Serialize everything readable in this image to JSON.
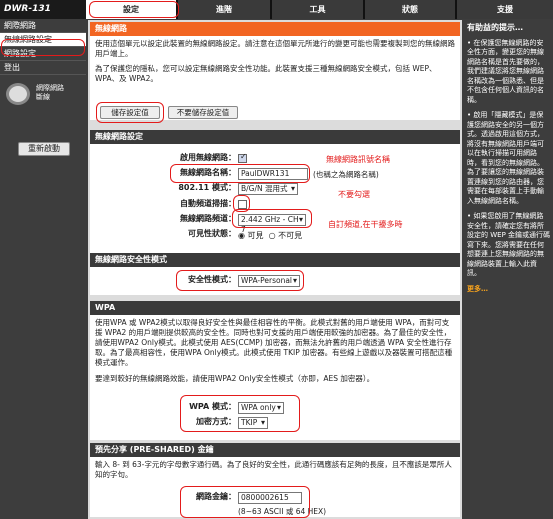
{
  "brand": "DWR-131",
  "tabs": [
    "設定",
    "進階",
    "工具",
    "狀態",
    "支援"
  ],
  "nav": [
    "網際網路",
    "無線網路設定",
    "網路設定",
    "登出"
  ],
  "sidebar": {
    "device_label": "網際網路\n斷線",
    "reboot": "重新啟動"
  },
  "wireless": {
    "title": "無線網路",
    "desc": "使用這個單元以設定此裝置的無線網路設定。請注意在這個單元所進行的變更可能也需要複製到您的無線網路用戶端上。",
    "desc2": "為了保護您的隱私，您可以設定無線網路安全性功能。此裝置支援三種無線網路安全模式，包括 WEP、WPA、及 WPA2。",
    "save": "儲存設定值",
    "nosave": "不要儲存設定值"
  },
  "settings": {
    "title": "無線網路設定",
    "enable_label": "啟用無線網路：",
    "name_label": "無線網路名稱：",
    "name_value": "PaulDWR131",
    "name_hint": "(也稱之為網路名稱)",
    "mode_label": "802.11 模式：",
    "mode_value": "B/G/N 混用式",
    "autochan_label": "自動頻道掃描：",
    "channel_label": "無線網路頻道：",
    "channel_value": "2.442 GHz - CH 7",
    "visible_label": "可見性狀態：",
    "visible_on": "可見",
    "visible_off": "不可見"
  },
  "annotations": {
    "ssid": "無線網路訊號名稱",
    "noscan": "不要勾選",
    "channel": "自訂頻道,在干擾多時"
  },
  "security": {
    "title": "無線網路安全性模式",
    "mode_label": "安全性模式：",
    "mode_value": "WPA-Personal"
  },
  "wpa": {
    "title": "WPA",
    "text": "使用WPA 或 WPA2模式以取得良好安全性與最佳相容性的平衡。此模式對舊的用戶端使用 WPA，而對可支援 WPA2 的用戶端則提供較高的安全性。同時也對可支援的用戶端使用較強的加密器。為了最佳的安全性，請使用WPA2 Only模式。此模式使用 AES(CCMP) 加密器，而無法允許舊的用戶端透過 WPA 安全性進行存取。為了最高相容性，使用WPA Only模式。此模式使用 TKIP 加密器。有些線上遊戲以及器裝置可搭配這種模式運作。",
    "text2": "要達到較好的無線網路效能，請使用WPA2 Only安全性模式（亦即，AES 加密器）。",
    "mode_label": "WPA 模式：",
    "mode_value": "WPA only",
    "cipher_label": "加密方式：",
    "cipher_value": "TKIP"
  },
  "psk": {
    "title": "預先分享 (PRE-SHARED) 金鑰",
    "text": "輸入 8- 到 63-字元的字母數字通行碼。為了良好的安全性，此通行碼應該有足夠的長度，且不應該是眾所人知的字句。",
    "key_label": "網路金鑰：",
    "key_value": "0800002615",
    "key_hint": "(8~63 ASCII 或 64 HEX)"
  },
  "help": {
    "title": "有助益的提示…",
    "p1": "• 在保護您無線網路的安全性方面，變更您的無線網路名稱是首先要做的，我們建議您將您無線網路名稱改為一個熟悉、但是不包含任何個人資訊的名稱。",
    "p2": "• 啟用「隱藏模式」是保護您網路安全的另一個方式。透過啟用這個方式，將沒有無線網路用戶端可以在執行掃描可用網路時，看到您的無線網路。為了要讓您的無線網路裝置連線到您的路由器，您需要在每部裝置上手動輸入無線網路名稱。",
    "p3": "• 如果您啟用了無線網路安全性，請確定您有將所設定的 WEP 金鑰或通行碼寫下來。您將需要在任何想要連上您無線網路的無線網路裝置上輸入此資訊。",
    "more": "更多…"
  }
}
